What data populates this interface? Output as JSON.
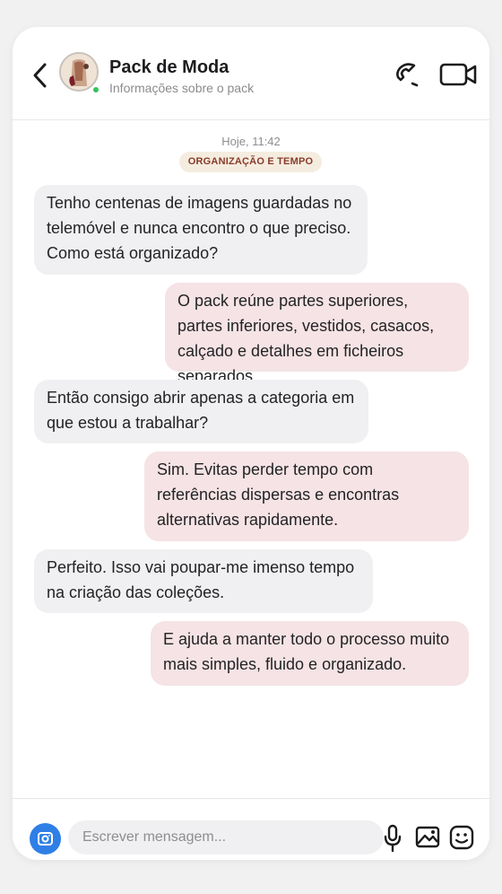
{
  "header": {
    "contact_name": "Pack de Moda",
    "subtitle": "Informações sobre o pack",
    "online": true
  },
  "conversation": {
    "timestamp": "Hoje, 11:42",
    "topic": "ORGANIZAÇÃO E TEMPO",
    "messages": [
      {
        "direction": "in",
        "text": "Tenho centenas de imagens guardadas no telemóvel e nunca encontro o que preciso. Como está organizado?"
      },
      {
        "direction": "out",
        "text": "O pack reúne partes superiores, partes inferiores, vestidos, casacos, calçado e detalhes em ficheiros separados."
      },
      {
        "direction": "in",
        "text": "Então consigo abrir apenas a categoria em que estou a trabalhar?"
      },
      {
        "direction": "out",
        "text": "Sim. Evitas perder tempo com referências dispersas e encontras alternativas rapidamente."
      },
      {
        "direction": "in",
        "text": "Perfeito. Isso vai poupar-me imenso tempo na criação das coleções."
      },
      {
        "direction": "out",
        "text": "E ajuda a manter todo o processo muito mais simples, fluido e organizado."
      }
    ]
  },
  "composer": {
    "placeholder": "Escrever mensagem..."
  },
  "icons": {
    "back": "chevron-left-icon",
    "call": "phone-icon",
    "video": "video-camera-icon",
    "camera": "camera-icon",
    "mic": "microphone-icon",
    "gallery": "image-icon",
    "emoji": "smiley-icon"
  },
  "colors": {
    "incoming_bubble": "#f0f0f2",
    "outgoing_bubble": "#f5e3e5",
    "badge_bg": "#f4eddf",
    "badge_text": "#8a3a2a",
    "online": "#35c15a",
    "camera_button": "#2f7fe6"
  }
}
